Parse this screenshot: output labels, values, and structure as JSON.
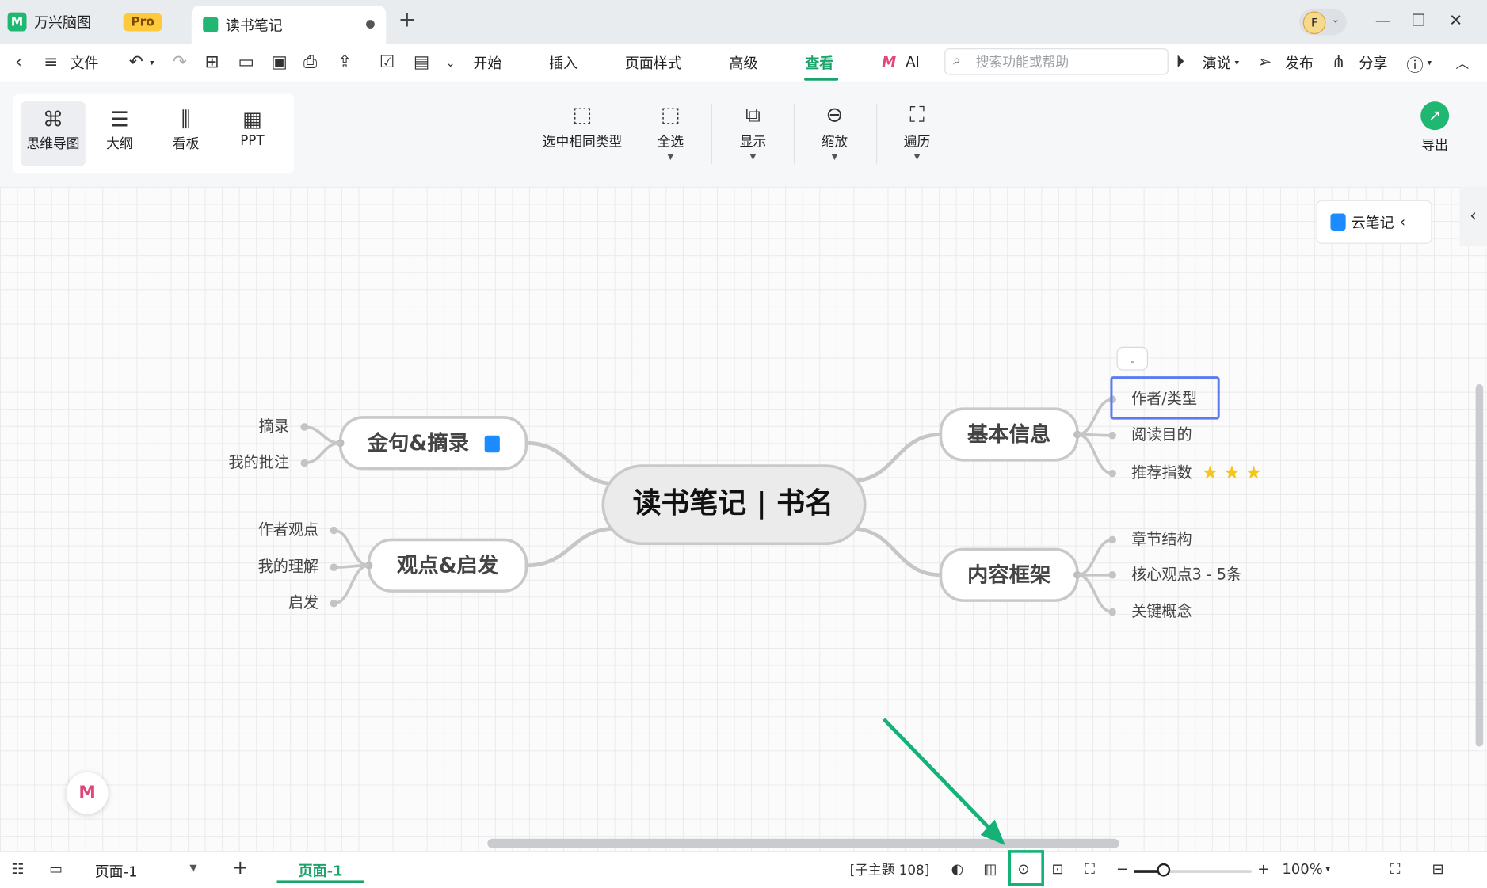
{
  "titlebar": {
    "app_name": "万兴脑图",
    "pro_badge": "Pro",
    "doc_tab": "读书笔记",
    "avatar_letter": "F"
  },
  "menubar": {
    "file": "文件",
    "items": [
      "开始",
      "插入",
      "页面样式",
      "高级",
      "查看",
      "AI"
    ],
    "active": "查看",
    "search_placeholder": "搜索功能或帮助",
    "present": "演说",
    "publish": "发布",
    "share": "分享"
  },
  "ribbon": {
    "views": [
      "思维导图",
      "大纲",
      "看板",
      "PPT"
    ],
    "selected_view": "思维导图",
    "tools": [
      "选中相同类型",
      "全选",
      "显示",
      "缩放",
      "遍历"
    ],
    "export": "导出"
  },
  "canvas": {
    "cloud_note": "云笔记",
    "mindmap": {
      "central": "读书笔记 | 书名",
      "branches": [
        {
          "label": "金句&摘录",
          "side": "left",
          "children": [
            "摘录",
            "我的批注"
          ]
        },
        {
          "label": "观点&启发",
          "side": "left",
          "children": [
            "作者观点",
            "我的理解",
            "启发"
          ]
        },
        {
          "label": "基本信息",
          "side": "right",
          "children": [
            "作者/类型",
            "阅读目的",
            "推荐指数"
          ]
        },
        {
          "label": "内容框架",
          "side": "right",
          "children": [
            "章节结构",
            "核心观点3 - 5条",
            "关键概念"
          ]
        }
      ],
      "rating_stars": 3,
      "selected_node": "作者/类型"
    }
  },
  "statusbar": {
    "page_select": "页面-1",
    "page_tab": "页面-1",
    "topic_count": "[子主题 108]",
    "zoom": "100%",
    "zoom_fraction": 0.25
  },
  "colors": {
    "accent": "#1aa36a",
    "highlight": "#14b276",
    "selection": "#5b7cf0",
    "star": "#f5c518"
  }
}
